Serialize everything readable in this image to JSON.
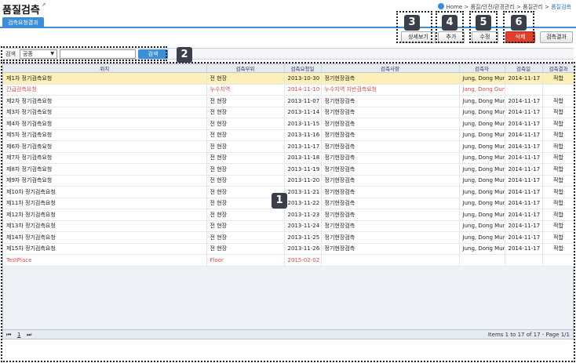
{
  "header": {
    "title": "품질검측",
    "pin_icon": "pin-icon",
    "breadcrumb": [
      "Home",
      "품질/안전/환경관리",
      "품질관리",
      "품질검측"
    ],
    "breadcrumb_sep": " > "
  },
  "tabs": [
    {
      "label": "검측요청결과",
      "active": true
    }
  ],
  "toolbar": {
    "detail_label": "상세보기",
    "add_label": "추가",
    "edit_label": "수정",
    "delete_label": "삭제",
    "result_label": "검측결과"
  },
  "search": {
    "label": "검색",
    "select_value": "공종",
    "input_value": "",
    "button_label": "검색"
  },
  "table": {
    "columns": [
      "위치",
      "검측부위",
      "검측요청일",
      "검측사항",
      "검측자",
      "검측일",
      "검측결과"
    ],
    "rows": [
      {
        "cells": [
          "제1차 정기검측요청",
          "전 현장",
          "2013-10-30",
          "정기현장검측",
          "Jung, Dong Mun",
          "2014-11-17",
          "적합"
        ],
        "style": "sel"
      },
      {
        "cells": [
          "긴급검측요청",
          "누수지역",
          "2014-11-10",
          "누수지역 지반검측요청",
          "Jang, Dong Gun",
          "",
          ""
        ],
        "style": "red"
      },
      {
        "cells": [
          "제2차 정기검측요청",
          "전 현장",
          "2013-11-07",
          "정기현장검측",
          "Jung, Dong Mun",
          "2014-11-17",
          "적합"
        ],
        "style": ""
      },
      {
        "cells": [
          "제3차 정기검측요청",
          "전 현장",
          "2013-11-14",
          "정기현장검측",
          "Jung, Dong Mun",
          "2014-11-17",
          "적합"
        ],
        "style": ""
      },
      {
        "cells": [
          "제4차 정기검측요청",
          "전 현장",
          "2013-11-15",
          "정기현장검측",
          "Jung, Dong Mun",
          "2014-11-17",
          "적합"
        ],
        "style": ""
      },
      {
        "cells": [
          "제5차 정기검측요청",
          "전 현장",
          "2013-11-16",
          "정기현장검측",
          "Jung, Dong Mun",
          "2014-11-17",
          "적합"
        ],
        "style": ""
      },
      {
        "cells": [
          "제6차 정기검측요청",
          "전 현장",
          "2013-11-17",
          "정기현장검측",
          "Jung, Dong Mun",
          "2014-11-17",
          "적합"
        ],
        "style": ""
      },
      {
        "cells": [
          "제7차 정기검측요청",
          "전 현장",
          "2013-11-18",
          "정기현장검측",
          "Jung, Dong Mun",
          "2014-11-17",
          "적합"
        ],
        "style": ""
      },
      {
        "cells": [
          "제8차 정기검측요청",
          "전 현장",
          "2013-11-19",
          "정기현장검측",
          "Jung, Dong Mun",
          "2014-11-17",
          "적합"
        ],
        "style": ""
      },
      {
        "cells": [
          "제9차 정기검측요청",
          "전 현장",
          "2013-11-20",
          "정기현장검측",
          "Jung, Dong Mun",
          "2014-11-17",
          "적합"
        ],
        "style": ""
      },
      {
        "cells": [
          "제10차 정기검측요청",
          "전 현장",
          "2013-11-21",
          "정기현장검측",
          "Jung, Dong Mun",
          "2014-11-17",
          "적합"
        ],
        "style": ""
      },
      {
        "cells": [
          "제11차 정기검측요청",
          "전 현장",
          "2013-11-22",
          "정기현장검측",
          "Jung, Dong Mun",
          "2014-11-17",
          "적합"
        ],
        "style": ""
      },
      {
        "cells": [
          "제12차 정기검측요청",
          "전 현장",
          "2013-11-23",
          "정기현장검측",
          "Jung, Dong Mun",
          "2014-11-17",
          "적합"
        ],
        "style": ""
      },
      {
        "cells": [
          "제13차 정기검측요청",
          "전 현장",
          "2013-11-24",
          "정기현장검측",
          "Jung, Dong Mun",
          "2014-11-17",
          "적합"
        ],
        "style": ""
      },
      {
        "cells": [
          "제14차 정기검측요청",
          "전 현장",
          "2013-11-25",
          "정기현장검측",
          "Jung, Dong Mun",
          "2014-11-17",
          "적합"
        ],
        "style": ""
      },
      {
        "cells": [
          "제15차 정기검측요청",
          "전 현장",
          "2013-11-26",
          "정기현장검측",
          "Jung, Dong Mun",
          "2014-11-17",
          "적합"
        ],
        "style": ""
      },
      {
        "cells": [
          "TestPlace",
          "Floor",
          "2015-02-02",
          "",
          "",
          "",
          ""
        ],
        "style": "red"
      }
    ]
  },
  "pager": {
    "first_label": "⏮",
    "page_label": "1",
    "last_label": "⏭",
    "info": "Items 1 to 17 of 17 - Page 1/1"
  },
  "callouts": [
    "1",
    "2",
    "3",
    "4",
    "5",
    "6"
  ],
  "colors": {
    "accent": "#3a8fd8",
    "danger": "#e0402a",
    "selected_row": "#fcf0b8",
    "error_text": "#e24a4a"
  }
}
